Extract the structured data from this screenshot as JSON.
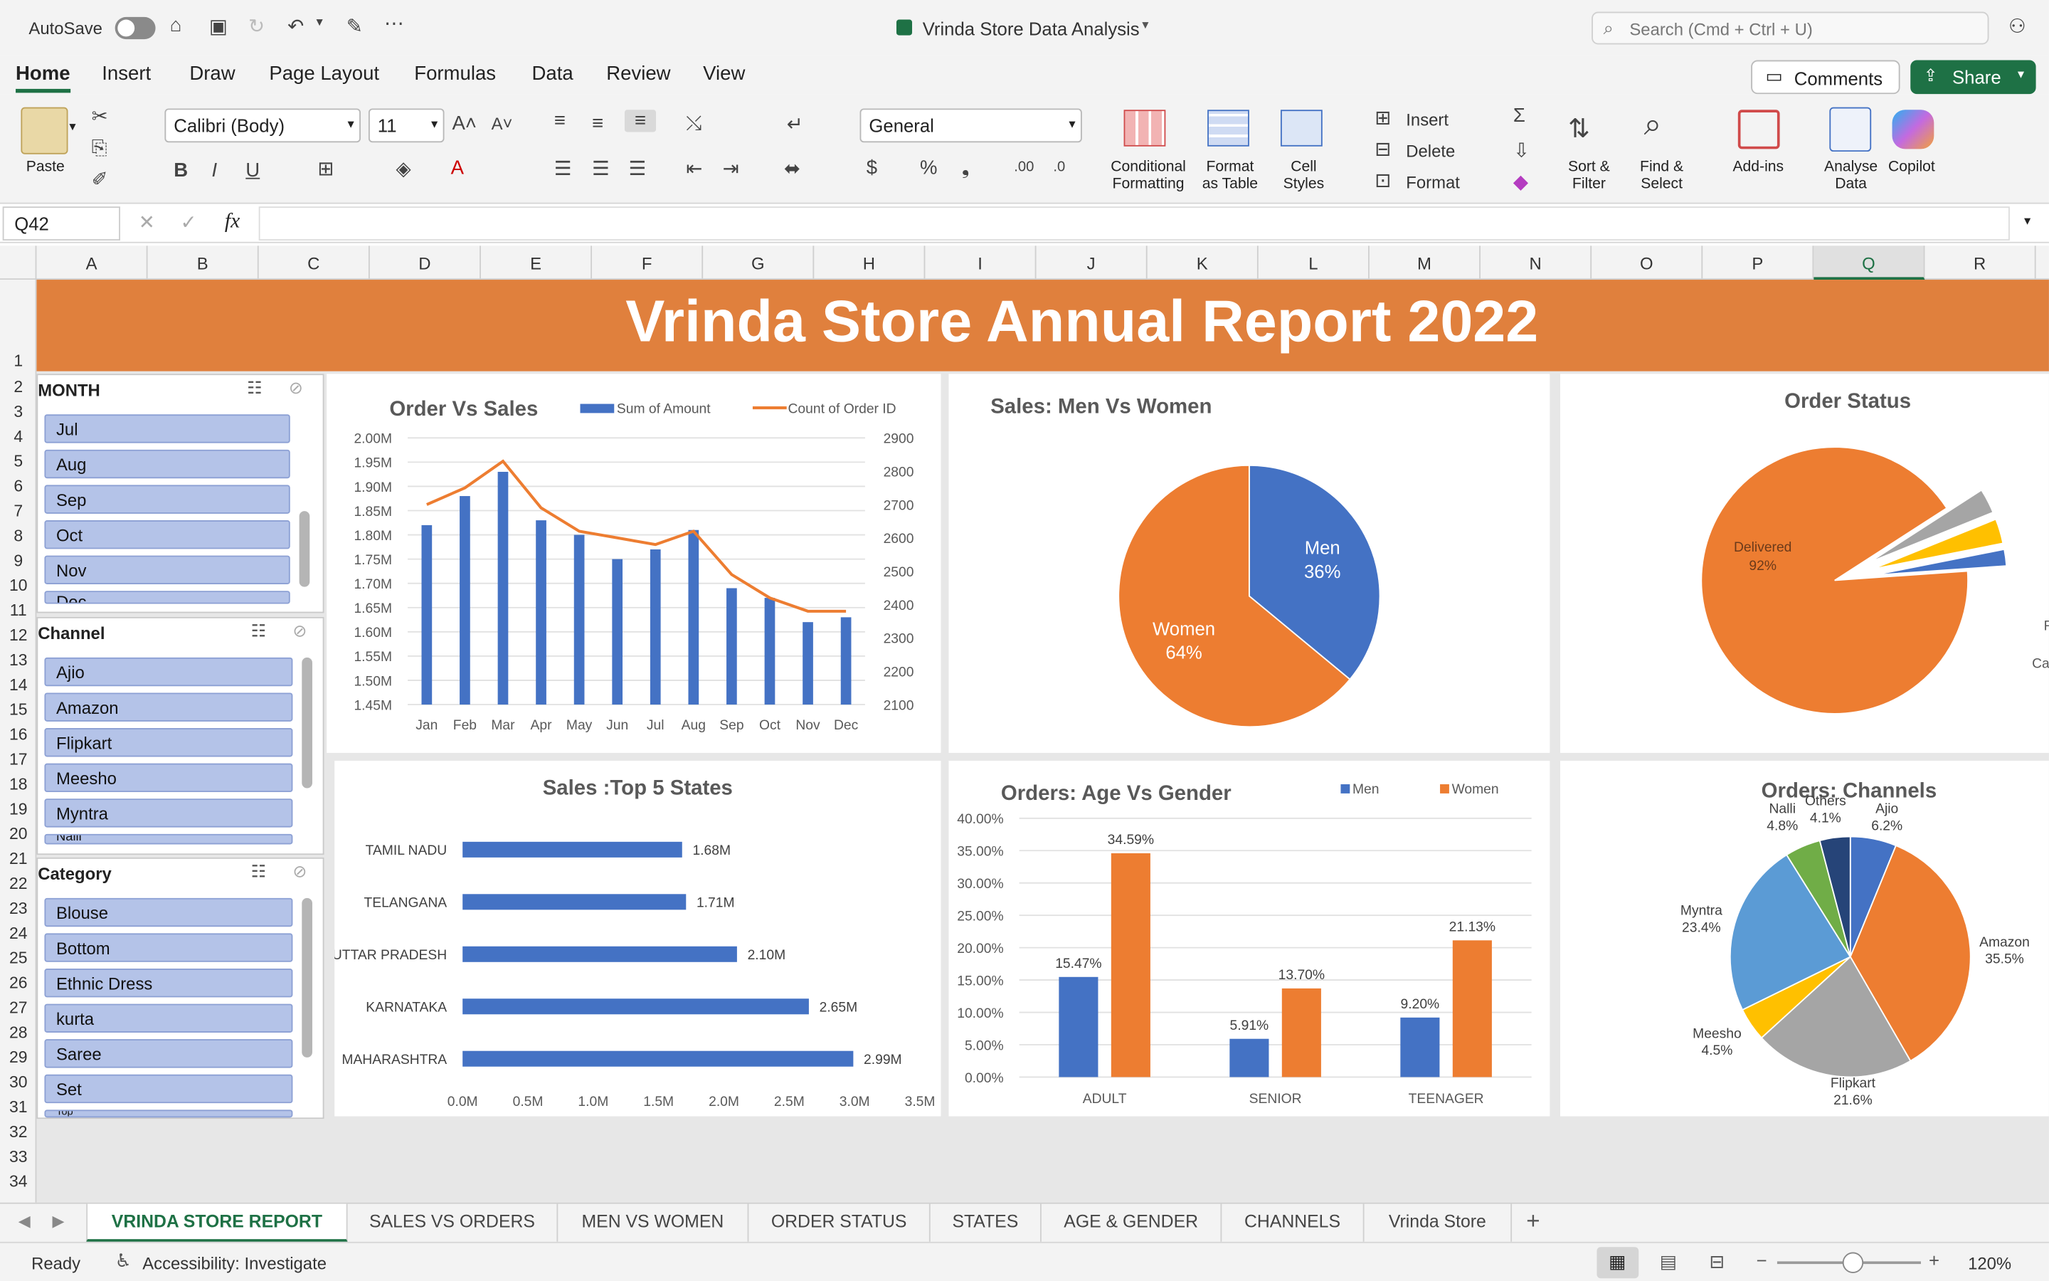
{
  "titlebar": {
    "autosave": "AutoSave",
    "doc_title": "Vrinda Store Data Analysis",
    "search_placeholder": "Search (Cmd + Ctrl + U)"
  },
  "ribbon_tabs": [
    "Home",
    "Insert",
    "Draw",
    "Page Layout",
    "Formulas",
    "Data",
    "Review",
    "View"
  ],
  "ribbon": {
    "comments": "Comments",
    "share": "Share",
    "paste": "Paste",
    "font_name": "Calibri (Body)",
    "font_size": "11",
    "number_format": "General",
    "conditional": "Conditional",
    "formatting": "Formatting",
    "format_as": "Format",
    "as_table": "as Table",
    "cell": "Cell",
    "styles": "Styles",
    "insert": "Insert",
    "delete": "Delete",
    "format": "Format",
    "sort": "Sort &",
    "filter": "Filter",
    "find": "Find &",
    "select": "Select",
    "addins": "Add-ins",
    "analyse": "Analyse",
    "data_lbl": "Data",
    "copilot": "Copilot"
  },
  "formula_bar": {
    "name_box": "Q42",
    "fx": "fx",
    "formula": ""
  },
  "columns": [
    "A",
    "B",
    "C",
    "D",
    "E",
    "F",
    "G",
    "H",
    "I",
    "J",
    "K",
    "L",
    "M",
    "N",
    "O",
    "P",
    "Q",
    "R"
  ],
  "rows": [
    "1",
    "2",
    "3",
    "4",
    "5",
    "6",
    "7",
    "8",
    "9",
    "10",
    "11",
    "12",
    "13",
    "14",
    "15",
    "16",
    "17",
    "18",
    "19",
    "20",
    "21",
    "22",
    "23",
    "24",
    "25",
    "26",
    "27",
    "28",
    "29",
    "30",
    "31",
    "32",
    "33",
    "34"
  ],
  "report_title": "Vrinda Store Annual Report 2022",
  "slicers": {
    "month": {
      "title": "MONTH",
      "items": [
        "Jul",
        "Aug",
        "Sep",
        "Oct",
        "Nov",
        "Dec"
      ]
    },
    "channel": {
      "title": "Channel",
      "items": [
        "Ajio",
        "Amazon",
        "Flipkart",
        "Meesho",
        "Myntra",
        "Nalli"
      ]
    },
    "category": {
      "title": "Category",
      "items": [
        "Blouse",
        "Bottom",
        "Ethnic Dress",
        "kurta",
        "Saree",
        "Set",
        "Top"
      ]
    }
  },
  "chart_data": [
    {
      "type": "bar",
      "title": "Order Vs Sales",
      "categories": [
        "Jan",
        "Feb",
        "Mar",
        "Apr",
        "May",
        "Jun",
        "Jul",
        "Aug",
        "Sep",
        "Oct",
        "Nov",
        "Dec"
      ],
      "series": [
        {
          "name": "Sum of Amount",
          "kind": "bar",
          "axis": "left",
          "color": "#4472C4",
          "values": [
            1.82,
            1.88,
            1.93,
            1.83,
            1.8,
            1.75,
            1.77,
            1.81,
            1.69,
            1.67,
            1.62,
            1.63
          ]
        },
        {
          "name": "Count of Order ID",
          "kind": "line",
          "axis": "right",
          "color": "#ED7D31",
          "values": [
            2700,
            2750,
            2830,
            2690,
            2620,
            2600,
            2580,
            2620,
            2490,
            2420,
            2380,
            2380
          ]
        }
      ],
      "yticks_left": [
        "1.45M",
        "1.50M",
        "1.55M",
        "1.60M",
        "1.65M",
        "1.70M",
        "1.75M",
        "1.80M",
        "1.85M",
        "1.90M",
        "1.95M",
        "2.00M"
      ],
      "ylim_left": [
        1.45,
        2.0
      ],
      "yticks_right": [
        "2100",
        "2200",
        "2300",
        "2400",
        "2500",
        "2600",
        "2700",
        "2800",
        "2900"
      ],
      "ylim_right": [
        2100,
        2900
      ],
      "legend": "top"
    },
    {
      "type": "pie",
      "title": "Sales: Men Vs Women",
      "slices": [
        {
          "label": "Men",
          "value": 36,
          "text": "36%",
          "color": "#4472C4"
        },
        {
          "label": "Women",
          "value": 64,
          "text": "64%",
          "color": "#ED7D31"
        }
      ]
    },
    {
      "type": "pie",
      "title": "Order Status",
      "slices": [
        {
          "label": "Delivered",
          "value": 92,
          "text": "92%",
          "color": "#ED7D31"
        },
        {
          "label": "Returned",
          "value": 3,
          "color": "#A5A5A5"
        },
        {
          "label": "Refunded",
          "value": 3,
          "color": "#FFC000"
        },
        {
          "label": "Cancelled",
          "value": 2,
          "color": "#4472C4"
        }
      ],
      "edge_labels": [
        "R",
        "Ca"
      ]
    },
    {
      "type": "bar",
      "orientation": "horizontal",
      "title": "Sales :Top 5 States",
      "categories": [
        "TAMIL NADU",
        "TELANGANA",
        "UTTAR PRADESH",
        "KARNATAKA",
        "MAHARASHTRA"
      ],
      "values": [
        1.68,
        1.71,
        2.1,
        2.65,
        2.99
      ],
      "labels": [
        "1.68M",
        "1.71M",
        "2.10M",
        "2.65M",
        "2.99M"
      ],
      "xticks": [
        "0.0M",
        "0.5M",
        "1.0M",
        "1.5M",
        "2.0M",
        "2.5M",
        "3.0M",
        "3.5M"
      ],
      "xlim": [
        0,
        3.5
      ],
      "color": "#4472C4"
    },
    {
      "type": "bar",
      "title": "Orders: Age Vs Gender",
      "categories": [
        "ADULT",
        "SENIOR",
        "TEENAGER"
      ],
      "series": [
        {
          "name": "Men",
          "color": "#4472C4",
          "values": [
            15.47,
            5.91,
            9.2
          ],
          "labels": [
            "15.47%",
            "5.91%",
            "9.20%"
          ]
        },
        {
          "name": "Women",
          "color": "#ED7D31",
          "values": [
            34.59,
            13.7,
            21.13
          ],
          "labels": [
            "34.59%",
            "13.70%",
            "21.13%"
          ]
        }
      ],
      "yticks": [
        "0.00%",
        "5.00%",
        "10.00%",
        "15.00%",
        "20.00%",
        "25.00%",
        "30.00%",
        "35.00%",
        "40.00%"
      ],
      "ylim": [
        0,
        40
      ],
      "legend": "top-right"
    },
    {
      "type": "pie",
      "title": "Orders: Channels",
      "slices": [
        {
          "label": "Ajio",
          "value": 6.2,
          "text": "6.2%",
          "color": "#4472C4"
        },
        {
          "label": "Amazon",
          "value": 35.5,
          "text": "35.5%",
          "color": "#ED7D31"
        },
        {
          "label": "Flipkart",
          "value": 21.6,
          "text": "21.6%",
          "color": "#A5A5A5"
        },
        {
          "label": "Meesho",
          "value": 4.5,
          "text": "4.5%",
          "color": "#FFC000"
        },
        {
          "label": "Myntra",
          "value": 23.4,
          "text": "23.4%",
          "color": "#5B9BD5"
        },
        {
          "label": "Nalli",
          "value": 4.8,
          "text": "4.8%",
          "color": "#70AD47"
        },
        {
          "label": "Others",
          "value": 4.1,
          "text": "4.1%",
          "color": "#264478"
        }
      ]
    }
  ],
  "sheet_tabs": [
    "VRINDA STORE REPORT",
    "SALES VS ORDERS",
    "MEN VS WOMEN",
    "ORDER STATUS",
    "STATES",
    "AGE & GENDER",
    "CHANNELS",
    "Vrinda Store"
  ],
  "status": {
    "ready": "Ready",
    "accessibility": "Accessibility: Investigate",
    "zoom": "120%"
  }
}
